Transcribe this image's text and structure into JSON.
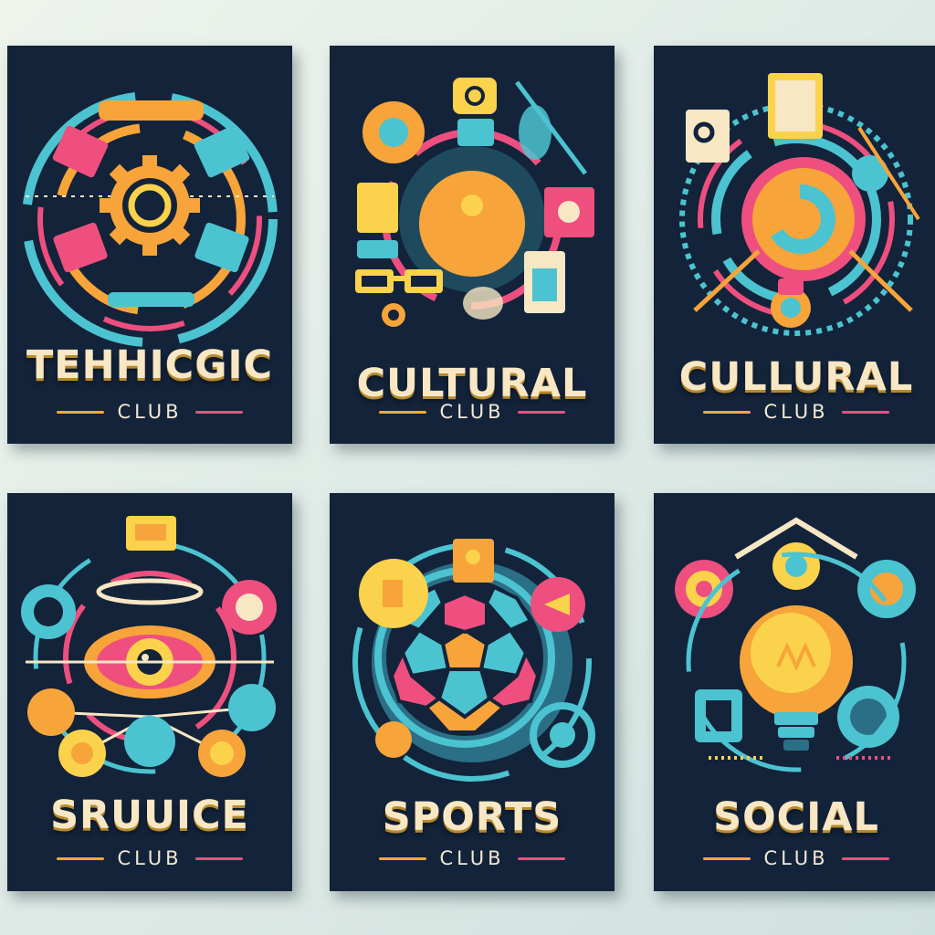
{
  "posters": [
    {
      "title": "TEHHICGIC",
      "subtitle": "CLUB"
    },
    {
      "title": "CULTURAL",
      "subtitle": "CLUB"
    },
    {
      "title": "CULLURAL",
      "subtitle": "CLUB"
    },
    {
      "title": "SRUUICE",
      "subtitle": "CLUB"
    },
    {
      "title": "SPORTS",
      "subtitle": "CLUB"
    },
    {
      "title": "SOCIAL",
      "subtitle": "CLUB"
    }
  ],
  "colors": {
    "background": "#e4eee9",
    "poster": "#13233a",
    "cyan": "#4cc3d0",
    "pink": "#ee4f7f",
    "orange": "#f7a43a",
    "yellow": "#fbd24c",
    "cream": "#f7e7c4"
  },
  "icons": [
    "gear-icon",
    "eye-icon",
    "soccer-ball-icon",
    "lightbulb-icon",
    "glasses-icon"
  ]
}
